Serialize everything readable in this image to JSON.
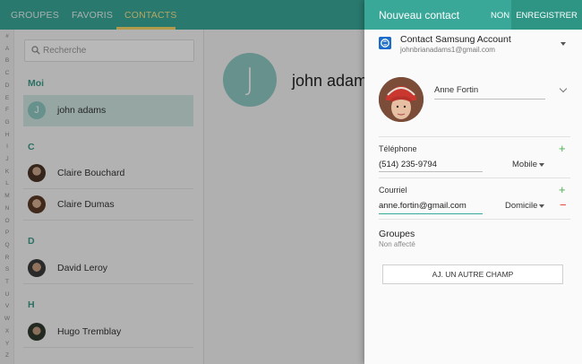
{
  "tabs": [
    {
      "label": "GROUPES"
    },
    {
      "label": "FAVORIS"
    },
    {
      "label": "CONTACTS",
      "active": true
    }
  ],
  "alphabet": [
    "#",
    "A",
    "B",
    "C",
    "D",
    "E",
    "F",
    "G",
    "H",
    "I",
    "J",
    "K",
    "L",
    "M",
    "N",
    "O",
    "P",
    "Q",
    "R",
    "S",
    "T",
    "U",
    "V",
    "W",
    "X",
    "Y",
    "Z"
  ],
  "search": {
    "placeholder": "Recherche"
  },
  "sections": [
    {
      "header": "Moi",
      "contacts": [
        {
          "name": "john adams",
          "initial": "J",
          "selected": true
        }
      ]
    },
    {
      "header": "C",
      "contacts": [
        {
          "name": "Claire Bouchard"
        },
        {
          "name": "Claire Dumas"
        }
      ]
    },
    {
      "header": "D",
      "contacts": [
        {
          "name": "David Leroy"
        }
      ]
    },
    {
      "header": "H",
      "contacts": [
        {
          "name": "Hugo Tremblay"
        }
      ]
    }
  ],
  "detail": {
    "initial": "J",
    "name": "john adams"
  },
  "panel": {
    "title": "Nouveau contact",
    "cancel_label": "NON",
    "save_label": "ENREGISTRER",
    "account": {
      "title": "Contact Samsung Account",
      "email": "johnbrianadams1@gmail.com"
    },
    "name_value": "Anne Fortin",
    "phone": {
      "label": "Téléphone",
      "value": "(514) 235-9794",
      "type": "Mobile"
    },
    "email": {
      "label": "Courriel",
      "value": "anne.fortin@gmail.com",
      "type": "Domicile"
    },
    "groups": {
      "label": "Groupes",
      "value": "Non affecté"
    },
    "add_field_label": "AJ. UN AUTRE CHAMP"
  },
  "colors": {
    "accent": "#3aa899",
    "tab_active": "#f7e58a",
    "add": "#4caf50",
    "remove": "#e53935"
  }
}
